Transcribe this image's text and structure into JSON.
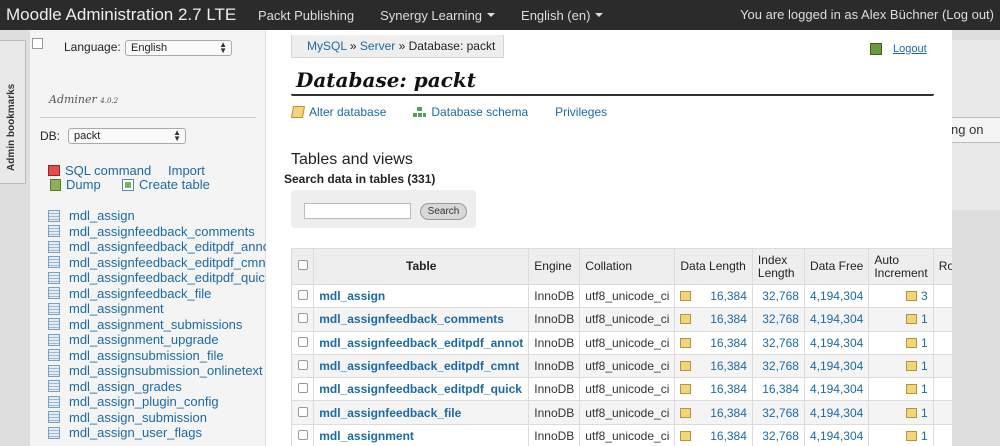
{
  "navbar": {
    "brand": "Moodle Administration 2.7 LTE",
    "items": [
      "Packt Publishing",
      "Synergy Learning",
      "English (en)"
    ],
    "login_text": "You are logged in as Alex Büchner (Log out)"
  },
  "background": {
    "bookmarks_tab": "Admin bookmarks",
    "right_button_fragment": "ng on"
  },
  "sidebar": {
    "language_label": "Language:",
    "language_value": "English",
    "logo": "Adminer",
    "logo_version": "4.0.2",
    "db_label": "DB:",
    "db_value": "packt",
    "sql_command": "SQL command",
    "import": "Import",
    "dump": "Dump",
    "create_table": "Create table",
    "tables": [
      "mdl_assign",
      "mdl_assignfeedback_comments",
      "mdl_assignfeedback_editpdf_anno",
      "mdl_assignfeedback_editpdf_cmn",
      "mdl_assignfeedback_editpdf_quic",
      "mdl_assignfeedback_file",
      "mdl_assignment",
      "mdl_assignment_submissions",
      "mdl_assignment_upgrade",
      "mdl_assignsubmission_file",
      "mdl_assignsubmission_onlinetext",
      "mdl_assign_grades",
      "mdl_assign_plugin_config",
      "mdl_assign_submission",
      "mdl_assign_user_flags"
    ]
  },
  "main": {
    "breadcrumb": {
      "mysql": "MySQL",
      "sep1": " » ",
      "server": "Server",
      "rest": " » Database: packt"
    },
    "logout": "Logout",
    "title": "Database: packt",
    "links": {
      "alter": "Alter database",
      "schema": "Database schema",
      "privileges": "Privileges"
    },
    "section_title": "Tables and views",
    "search_title": "Search data in tables (331)",
    "search_button": "Search",
    "table": {
      "headers": {
        "table": "Table",
        "engine": "Engine",
        "collation": "Collation",
        "data_length": "Data Length",
        "index_length_1": "Index",
        "index_length_2": "Length",
        "data_free": "Data Free",
        "auto_inc_1": "Auto",
        "auto_inc_2": "Increment",
        "rows": "Ro"
      },
      "rows": [
        {
          "name": "mdl_assign",
          "engine": "InnoDB",
          "collation": "utf8_unicode_ci",
          "data_length": "16,384",
          "index_length": "32,768",
          "data_free": "4,194,304",
          "auto_increment": "3"
        },
        {
          "name": "mdl_assignfeedback_comments",
          "engine": "InnoDB",
          "collation": "utf8_unicode_ci",
          "data_length": "16,384",
          "index_length": "32,768",
          "data_free": "4,194,304",
          "auto_increment": "1"
        },
        {
          "name": "mdl_assignfeedback_editpdf_annot",
          "engine": "InnoDB",
          "collation": "utf8_unicode_ci",
          "data_length": "16,384",
          "index_length": "32,768",
          "data_free": "4,194,304",
          "auto_increment": "1"
        },
        {
          "name": "mdl_assignfeedback_editpdf_cmnt",
          "engine": "InnoDB",
          "collation": "utf8_unicode_ci",
          "data_length": "16,384",
          "index_length": "32,768",
          "data_free": "4,194,304",
          "auto_increment": "1"
        },
        {
          "name": "mdl_assignfeedback_editpdf_quick",
          "engine": "InnoDB",
          "collation": "utf8_unicode_ci",
          "data_length": "16,384",
          "index_length": "16,384",
          "data_free": "4,194,304",
          "auto_increment": "1"
        },
        {
          "name": "mdl_assignfeedback_file",
          "engine": "InnoDB",
          "collation": "utf8_unicode_ci",
          "data_length": "16,384",
          "index_length": "32,768",
          "data_free": "4,194,304",
          "auto_increment": "1"
        },
        {
          "name": "mdl_assignment",
          "engine": "InnoDB",
          "collation": "utf8_unicode_ci",
          "data_length": "16,384",
          "index_length": "32,768",
          "data_free": "4,194,304",
          "auto_increment": "1"
        }
      ]
    }
  }
}
